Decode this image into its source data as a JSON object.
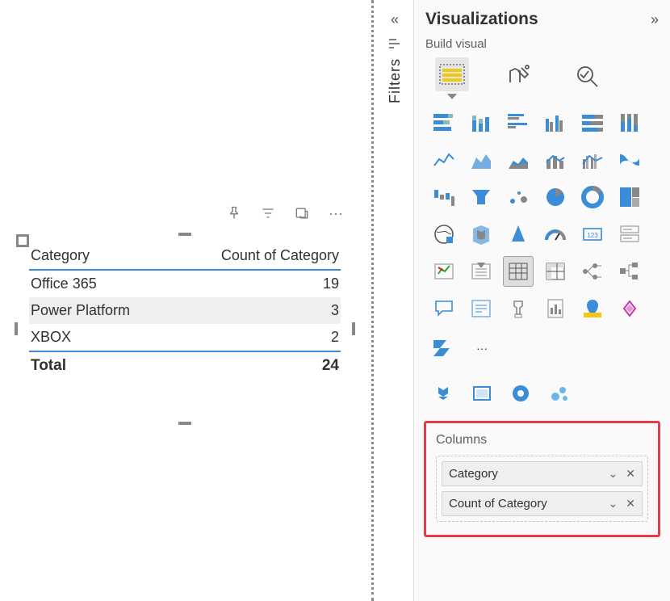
{
  "panes": {
    "filters_label": "Filters",
    "visualizations_title": "Visualizations",
    "build_visual": "Build visual"
  },
  "table": {
    "header_col1": "Category",
    "header_col2": "Count of Category",
    "rows": [
      {
        "cat": "Office 365",
        "count": "19"
      },
      {
        "cat": "Power Platform",
        "count": "3"
      },
      {
        "cat": "XBOX",
        "count": "2"
      }
    ],
    "total_label": "Total",
    "total_value": "24"
  },
  "columns": {
    "section_label": "Columns",
    "fields": [
      {
        "name": "Category"
      },
      {
        "name": "Count of Category"
      }
    ]
  },
  "more": "···",
  "selected_visual": "table"
}
